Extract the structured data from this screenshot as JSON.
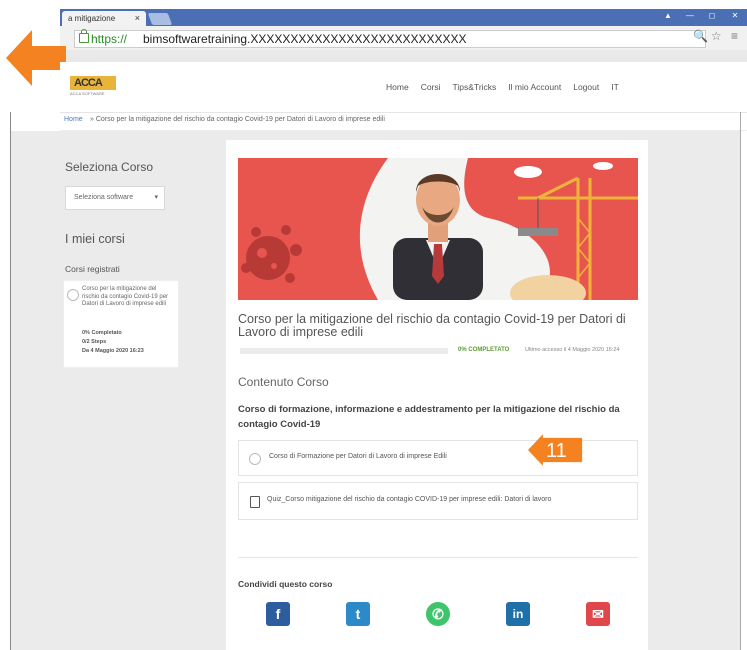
{
  "browser": {
    "tab_title": "a mitigazione",
    "tab_close": "×",
    "url_https": "https://",
    "url_rest": "bimsoftwaretraining.XXXXXXXXXXXXXXXXXXXXXXXXXXX",
    "addr_icons": "🔍☆ ≡",
    "win_buttons": [
      "▲",
      "—",
      "◻",
      "✕"
    ]
  },
  "header": {
    "logo_text": "ACCA",
    "logo_sub": "ACCA SOFTWARE",
    "nav": [
      "Home",
      "Corsi",
      "Tips&Tricks",
      "Il mio Account",
      "Logout",
      "IT"
    ]
  },
  "breadcrumb": {
    "home": "Home",
    "rest": "» Corso per la mitigazione del rischio da contagio Covid-19 per Datori di Lavoro di imprese edili"
  },
  "sidebar": {
    "select_heading": "Seleziona Corso",
    "select_value": "Seleziona software",
    "my_courses_heading": "I miei corsi",
    "registered_label": "Corsi registrati",
    "registered_course": {
      "title": "Corso per la mitigazione del rischio da contagio Covid-19 per Datori di Lavoro di imprese edili",
      "completed": "0% Completato",
      "steps": "0/2 Steps",
      "date": "Da 4 Maggio 2020 16:23"
    }
  },
  "course": {
    "title": "Corso per la mitigazione del rischio da contagio Covid-19 per Datori di Lavoro di imprese edili",
    "progress_percent": 0,
    "progress_label": "0% COMPLETATO",
    "last_access": "Ultimo accesso il 4 Maggio 2020 16:24",
    "content_heading": "Contenuto Corso",
    "description": "Corso di formazione, informazione e addestramento per la mitigazione del rischio da contagio Covid-19",
    "lessons": [
      {
        "title": "Corso di Formazione per Datori di Lavoro di imprese Edili"
      },
      {
        "title": "Quiz_Corso mitigazione del rischio da contagio COVID-19 per imprese edili: Datori di lavoro"
      }
    ],
    "share_heading": "Condividi questo corso"
  },
  "social": [
    {
      "name": "facebook",
      "glyph": "f",
      "color": "#2d5d9e"
    },
    {
      "name": "twitter",
      "glyph": "t",
      "color": "#2b8ac7"
    },
    {
      "name": "whatsapp",
      "glyph": "✆",
      "color": "#3ec46a"
    },
    {
      "name": "linkedin",
      "glyph": "in",
      "color": "#1f6fa8"
    },
    {
      "name": "email",
      "glyph": "✉",
      "color": "#e0474a"
    }
  ],
  "annotations": {
    "step_number": "11"
  },
  "colors": {
    "accent_orange": "#f58220",
    "banner_red": "#e8554f",
    "progress_green": "#5fb85a",
    "chrome_blue": "#4a6fb5"
  }
}
